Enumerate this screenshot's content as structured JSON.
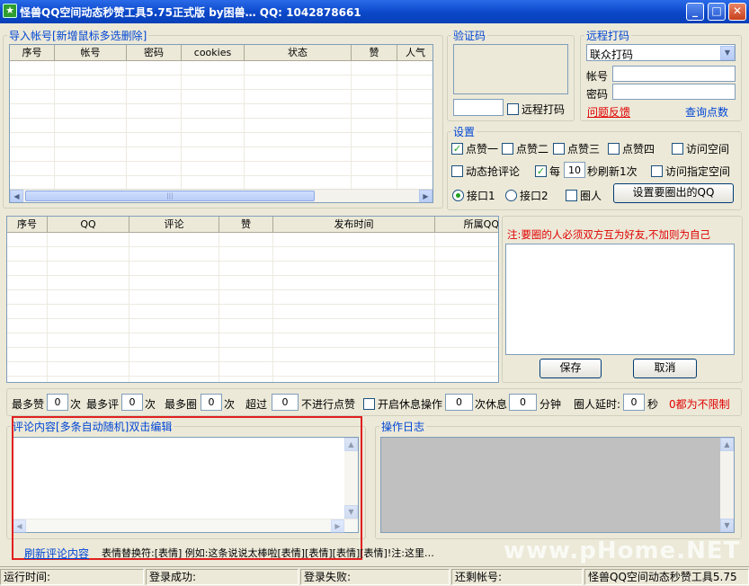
{
  "window": {
    "title": "怪兽QQ空间动态秒赞工具5.75正式版  by困兽…  QQ: 1042878661",
    "app_icon_glyph": "★"
  },
  "accounts": {
    "legend": "导入帐号[新增鼠标多选删除]",
    "columns": [
      "序号",
      "帐号",
      "密码",
      "cookies",
      "状态",
      "赞",
      "人气"
    ]
  },
  "captcha": {
    "legend": "验证码",
    "input_value": "",
    "remote_label": "远程打码",
    "remote_checked": false
  },
  "remote": {
    "legend": "远程打码",
    "selected": "联众打码",
    "account_label": "帐号",
    "password_label": "密码",
    "account_value": "",
    "password_value": "",
    "feedback_link": "问题反馈",
    "query_link": "查询点数"
  },
  "settings": {
    "legend": "设置",
    "like": [
      {
        "label": "点赞一",
        "checked": true
      },
      {
        "label": "点赞二",
        "checked": false
      },
      {
        "label": "点赞三",
        "checked": false
      },
      {
        "label": "点赞四",
        "checked": false
      }
    ],
    "visit_space": {
      "label": "访问空间",
      "checked": false
    },
    "dynamic_comment": {
      "label": "动态抢评论",
      "checked": false
    },
    "every": {
      "label": "每",
      "checked": true,
      "value": "10",
      "suffix": "秒刷新1次"
    },
    "visit_specified": {
      "label": "访问指定空间",
      "checked": false
    },
    "port1": {
      "label": "接口1",
      "selected": true
    },
    "port2": {
      "label": "接口2",
      "selected": false
    },
    "circle_person": {
      "label": "圈人",
      "checked": false
    },
    "set_circle_button": "设置要圈出的QQ"
  },
  "feed": {
    "columns": [
      "序号",
      "QQ",
      "评论",
      "赞",
      "发布时间",
      "所属QQ"
    ]
  },
  "circle": {
    "note": "注:要圈的人必须双方互为好友,不加则为自己",
    "save_button": "保存",
    "cancel_button": "取消"
  },
  "limits": {
    "max_like_label": "最多赞",
    "max_like": "0",
    "times1": "次",
    "max_comment_label": "最多评",
    "max_comment": "0",
    "times2": "次",
    "max_circle_label": "最多圈",
    "max_circle": "0",
    "times3": "次",
    "over_label": "超过",
    "over_value": "0",
    "no_like_label": "不进行点赞",
    "rest_label": "开启休息操作",
    "rest_checked": false,
    "rest_times": "0",
    "rest_times_label": "次休息",
    "rest_minutes": "0",
    "minutes_label": "分钟",
    "circle_delay_label": "圈人延时:",
    "circle_delay": "0",
    "seconds_label": "秒",
    "zero_note": "0都为不限制"
  },
  "comment_content": {
    "legend": "评论内容[多条自动随机]双击编辑"
  },
  "op_log": {
    "legend": "操作日志"
  },
  "bottom": {
    "refresh_link": "刷新评论内容",
    "hint": "表情替换符:[表情]  例如:这条说说太棒啦[表情][表情][表情][表情]!注:这里…",
    "watermark": "www.pHome.NET"
  },
  "status": {
    "run_time": "运行时间:",
    "login_ok": "登录成功:",
    "login_fail": "登录失败:",
    "remaining": "还剩帐号:",
    "app_name": "怪兽QQ空间动态秒赞工具5.75"
  },
  "colors": {
    "highlight_box": "#e02020",
    "link_red": "#e00000",
    "legend_blue": "#0046d5"
  }
}
